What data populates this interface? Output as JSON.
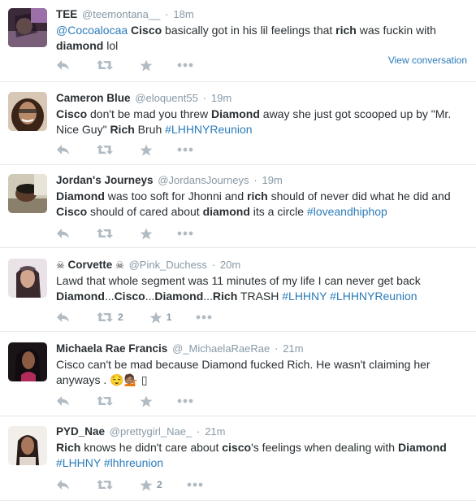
{
  "tweets": [
    {
      "name": "TEE",
      "handle": "@teemontana__",
      "time": "18m",
      "segments": [
        {
          "t": "@Cocoalocaa",
          "s": "link"
        },
        {
          "t": " "
        },
        {
          "t": "Cisco",
          "s": "b"
        },
        {
          "t": " basically got in his lil feelings that "
        },
        {
          "t": "rich",
          "s": "b"
        },
        {
          "t": " was fuckin with "
        },
        {
          "t": "diamond",
          "s": "b"
        },
        {
          "t": " lol"
        }
      ],
      "retweet_count": "",
      "favorite_count": "",
      "view_conversation": "View conversation"
    },
    {
      "name": "Cameron Blue",
      "handle": "@eloquent55",
      "time": "19m",
      "segments": [
        {
          "t": "Cisco",
          "s": "b"
        },
        {
          "t": " don't be mad you threw "
        },
        {
          "t": "Diamond",
          "s": "b"
        },
        {
          "t": " away she just got scooped up by \"Mr. Nice Guy\" "
        },
        {
          "t": "Rich",
          "s": "b"
        },
        {
          "t": " Bruh "
        },
        {
          "t": "#LHHNYReunion",
          "s": "link"
        }
      ],
      "retweet_count": "",
      "favorite_count": ""
    },
    {
      "name": "Jordan's Journeys",
      "handle": "@JordansJourneys",
      "time": "19m",
      "segments": [
        {
          "t": "Diamond",
          "s": "b"
        },
        {
          "t": " was too soft for Jhonni and "
        },
        {
          "t": "rich",
          "s": "b"
        },
        {
          "t": " should of never did what he did and "
        },
        {
          "t": "Cisco",
          "s": "b"
        },
        {
          "t": " should of cared about "
        },
        {
          "t": "diamond",
          "s": "b"
        },
        {
          "t": " its a circle "
        },
        {
          "t": "#loveandhiphop",
          "s": "link"
        }
      ],
      "retweet_count": "",
      "favorite_count": ""
    },
    {
      "name": "Corvette",
      "name_emblem": "☠",
      "handle": "@Pink_Duchess",
      "time": "20m",
      "segments": [
        {
          "t": "Lawd that whole segment was 11 minutes of my life I can never get back "
        },
        {
          "t": "Diamond",
          "s": "b"
        },
        {
          "t": "..."
        },
        {
          "t": "Cisco",
          "s": "b"
        },
        {
          "t": "..."
        },
        {
          "t": "Diamond",
          "s": "b"
        },
        {
          "t": "..."
        },
        {
          "t": "Rich",
          "s": "b"
        },
        {
          "t": " TRASH "
        },
        {
          "t": "#LHHNY",
          "s": "link"
        },
        {
          "t": " "
        },
        {
          "t": "#LHHNYReunion",
          "s": "link"
        }
      ],
      "retweet_count": "2",
      "favorite_count": "1"
    },
    {
      "name": "Michaela Rae Francis",
      "handle": "@_MichaelaRaeRae",
      "time": "21m",
      "segments": [
        {
          "t": "Cisco can't be mad because Diamond fucked Rich. He wasn't claiming her anyways . 😌💁🏽 ▯"
        }
      ],
      "retweet_count": "",
      "favorite_count": ""
    },
    {
      "name": "PYD_Nae",
      "handle": "@prettygirl_Nae_",
      "time": "21m",
      "segments": [
        {
          "t": "Rich",
          "s": "b"
        },
        {
          "t": " knows he didn't care about "
        },
        {
          "t": "cisco",
          "s": "b"
        },
        {
          "t": "'s feelings when dealing with "
        },
        {
          "t": "Diamond",
          "s": "b"
        },
        {
          "t": " "
        },
        {
          "t": "#LHHNY",
          "s": "link"
        },
        {
          "t": " "
        },
        {
          "t": "#lhhreunion",
          "s": "link"
        }
      ],
      "retweet_count": "",
      "favorite_count": "2"
    }
  ],
  "colors": {
    "link": "#2b7bb9",
    "name": "#292f33",
    "meta": "#8899a6",
    "action_icon": "#b1bbc3",
    "divider": "#e1e8ed"
  },
  "icons": [
    "reply-icon",
    "retweet-icon",
    "favorite-star-icon",
    "more-dots-icon"
  ]
}
